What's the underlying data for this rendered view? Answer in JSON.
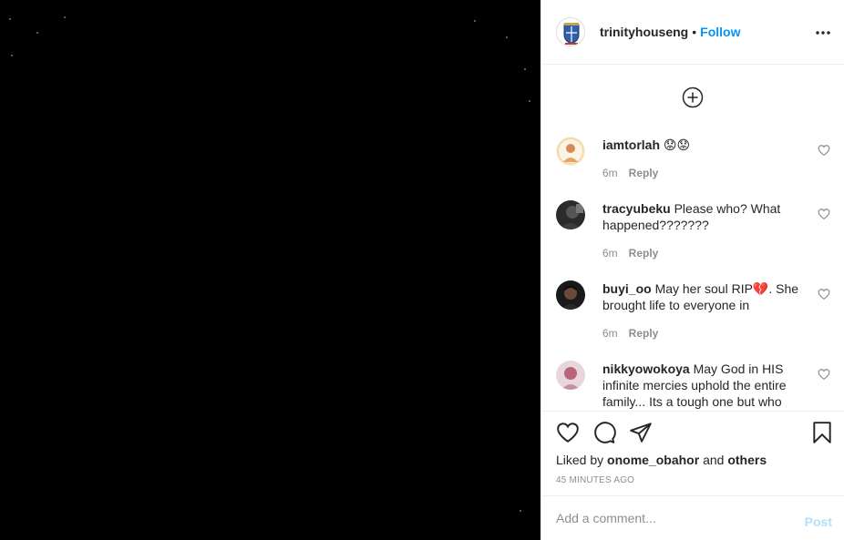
{
  "post": {
    "author": "trinityhouseng",
    "separator": "•",
    "follow_label": "Follow",
    "more_icon": "more-options-icon"
  },
  "comments": [
    {
      "username": "iamtorlah",
      "text": "😟😟",
      "time": "6m",
      "reply_label": "Reply"
    },
    {
      "username": "tracyubeku",
      "text": "Please who? What happened???????",
      "time": "6m",
      "reply_label": "Reply"
    },
    {
      "username": "buyi_oo",
      "text": "May her soul RIP💔. She brought life to everyone in",
      "time": "6m",
      "reply_label": "Reply"
    },
    {
      "username": "nikkyowokoya",
      "text": "May God in HIS infinite mercies uphold the entire family... Its a tough one but who",
      "time": "",
      "reply_label": ""
    }
  ],
  "engagement": {
    "liked_by_prefix": "Liked by",
    "liked_by_user": "onome_obahor",
    "liked_by_join": "and",
    "liked_by_suffix": "others",
    "timestamp": "45 MINUTES AGO"
  },
  "compose": {
    "placeholder": "Add a comment...",
    "post_label": "Post"
  },
  "colors": {
    "accent": "#0095f6",
    "post_disabled": "#b2dffc",
    "muted": "#8e8e8e"
  }
}
